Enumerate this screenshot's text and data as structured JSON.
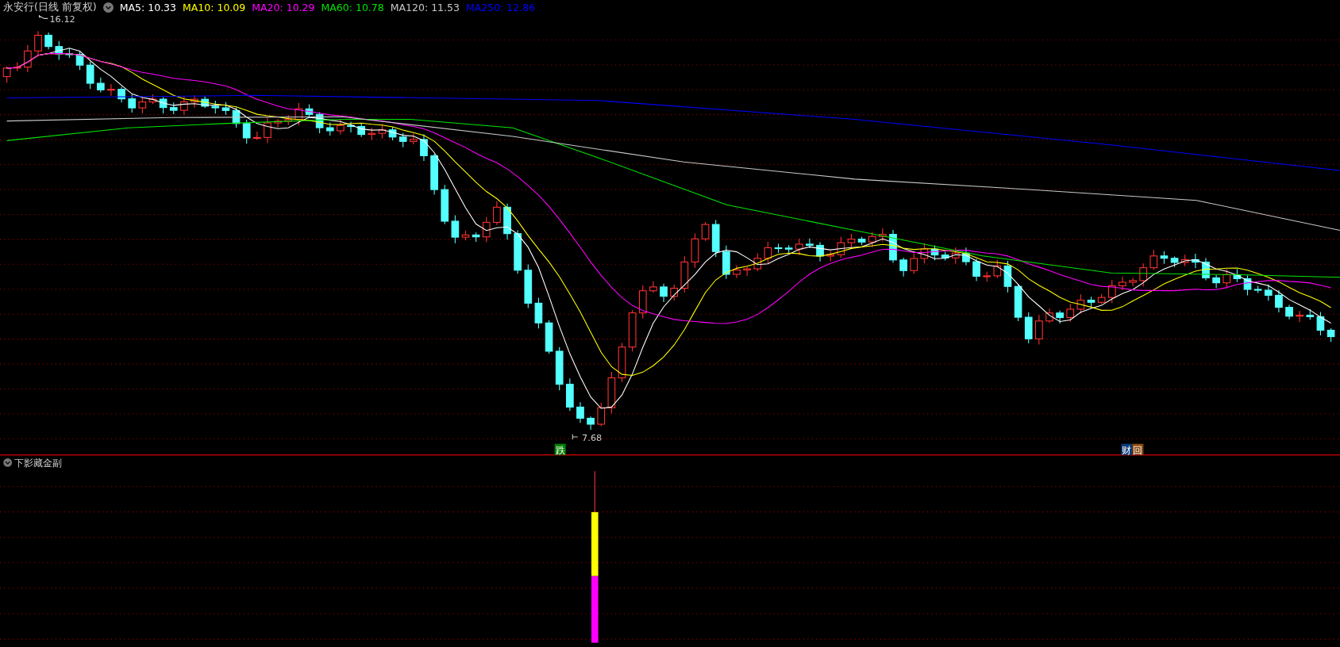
{
  "header": {
    "title": "永安行(日线 前复权)",
    "ma_legend": [
      {
        "label": "MA5:",
        "value": "10.33",
        "color": "#ffffff"
      },
      {
        "label": "MA10:",
        "value": "10.09",
        "color": "#ffff00"
      },
      {
        "label": "MA20:",
        "value": "10.29",
        "color": "#ff00ff"
      },
      {
        "label": "MA60:",
        "value": "10.78",
        "color": "#00e600"
      },
      {
        "label": "MA120:",
        "value": "11.53",
        "color": "#c8c8c8"
      },
      {
        "label": "MA250:",
        "value": "12.86",
        "color": "#0000ff"
      }
    ]
  },
  "main_chart": {
    "high_label": "16.12",
    "low_label": "7.68",
    "markers": [
      {
        "text": "跌",
        "color": "#008000"
      },
      {
        "text": "财",
        "color": "#0a3c78"
      },
      {
        "text": "回",
        "color": "#8a4a10"
      }
    ]
  },
  "sub_panel": {
    "title": "下影藏金副"
  }
}
